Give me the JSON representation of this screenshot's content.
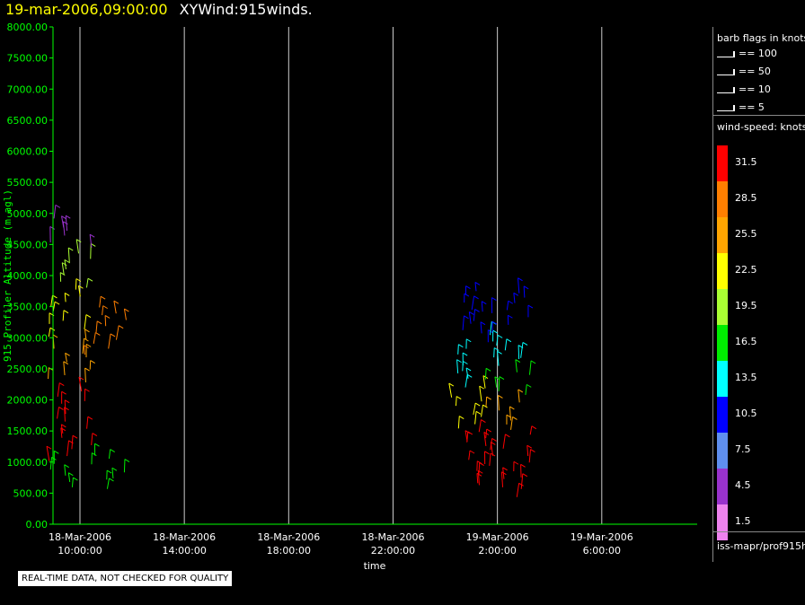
{
  "header": {
    "date": "19-mar-2006,09:00:00",
    "title": "XYWind:915winds."
  },
  "chart_data": {
    "type": "wind-barb time-height",
    "ylabel": "915 Profiler Altitude (m agl)",
    "xlabel": "time",
    "ylim": [
      0,
      8000
    ],
    "y_ticks": [
      "0.00",
      "500.00",
      "1000.00",
      "1500.00",
      "2000.00",
      "2500.00",
      "3000.00",
      "3500.00",
      "4000.00",
      "4500.00",
      "5000.00",
      "5500.00",
      "6000.00",
      "6500.00",
      "7000.00",
      "7500.00",
      "8000.00"
    ],
    "x_ticks": [
      {
        "date": "18-Mar-2006",
        "time": "10:00:00"
      },
      {
        "date": "18-Mar-2006",
        "time": "14:00:00"
      },
      {
        "date": "18-Mar-2006",
        "time": "18:00:00"
      },
      {
        "date": "18-Mar-2006",
        "time": "22:00:00"
      },
      {
        "date": "19-Mar-2006",
        "time": "2:00:00"
      },
      {
        "date": "19-Mar-2006",
        "time": "6:00:00"
      }
    ],
    "grid": "vertical lines at x ticks",
    "series": [
      {
        "group": "18-Mar 10:00",
        "x_hours": 9.6,
        "bands": [
          {
            "alt": [
              550,
              1000
            ],
            "speed": 16.5
          },
          {
            "alt": [
              1000,
              2200
            ],
            "speed": 31.5
          },
          {
            "alt": [
              2200,
              3000
            ],
            "speed": 25.5
          },
          {
            "alt": [
              3000,
              3800
            ],
            "speed": 22.5
          },
          {
            "alt": [
              3800,
              4400
            ],
            "speed": 19.5
          },
          {
            "alt": [
              4400,
              4950
            ],
            "speed": 4.5
          }
        ]
      },
      {
        "group": "18-Mar 11:00",
        "x_hours": 11.0,
        "bands": [
          {
            "alt": [
              550,
              1150
            ],
            "speed": 16.5
          },
          {
            "alt": [
              2700,
              3550
            ],
            "speed": 28.5
          }
        ]
      },
      {
        "group": "19-Mar 01:00",
        "x_hours": 25.1,
        "bands": [
          {
            "alt": [
              550,
              1500
            ],
            "speed": 31.5
          },
          {
            "alt": [
              1500,
              2200
            ],
            "speed": 22.5
          },
          {
            "alt": [
              2200,
              2900
            ],
            "speed": 13.5
          },
          {
            "alt": [
              2900,
              3800
            ],
            "speed": 10.5
          }
        ]
      },
      {
        "group": "19-Mar 02:00",
        "x_hours": 26.4,
        "bands": [
          {
            "alt": [
              400,
              1500
            ],
            "speed": 31.5
          },
          {
            "alt": [
              1500,
              2000
            ],
            "speed": 25.5
          },
          {
            "alt": [
              2000,
              2500
            ],
            "speed": 16.5
          },
          {
            "alt": [
              2500,
              3100
            ],
            "speed": 13.5
          },
          {
            "alt": [
              3100,
              3750
            ],
            "speed": 10.5
          }
        ]
      }
    ]
  },
  "legend": {
    "barb_title": "barb flags in knots",
    "barbs": [
      "== 100",
      "== 50",
      "== 10",
      "== 5"
    ],
    "speed_title": "wind-speed: knots",
    "speeds": [
      {
        "label": "31.5",
        "color": "#ff0000"
      },
      {
        "label": "28.5",
        "color": "#ff7f00"
      },
      {
        "label": "25.5",
        "color": "#ffa500"
      },
      {
        "label": "22.5",
        "color": "#ffff00"
      },
      {
        "label": "19.5",
        "color": "#aaff33"
      },
      {
        "label": "16.5",
        "color": "#00ee00"
      },
      {
        "label": "13.5",
        "color": "#00ffff"
      },
      {
        "label": "10.5",
        "color": "#0000ff"
      },
      {
        "label": "7.5",
        "color": "#5f8fef"
      },
      {
        "label": "4.5",
        "color": "#9932cc"
      },
      {
        "label": "1.5",
        "color": "#ee82ee"
      }
    ],
    "source": "iss-mapr/prof915h"
  },
  "footer": {
    "note": "REAL-TIME DATA, NOT CHECKED FOR QUALITY"
  },
  "colors": {
    "axis": "#00ff00",
    "grid": "#cccccc",
    "background": "#000000"
  }
}
